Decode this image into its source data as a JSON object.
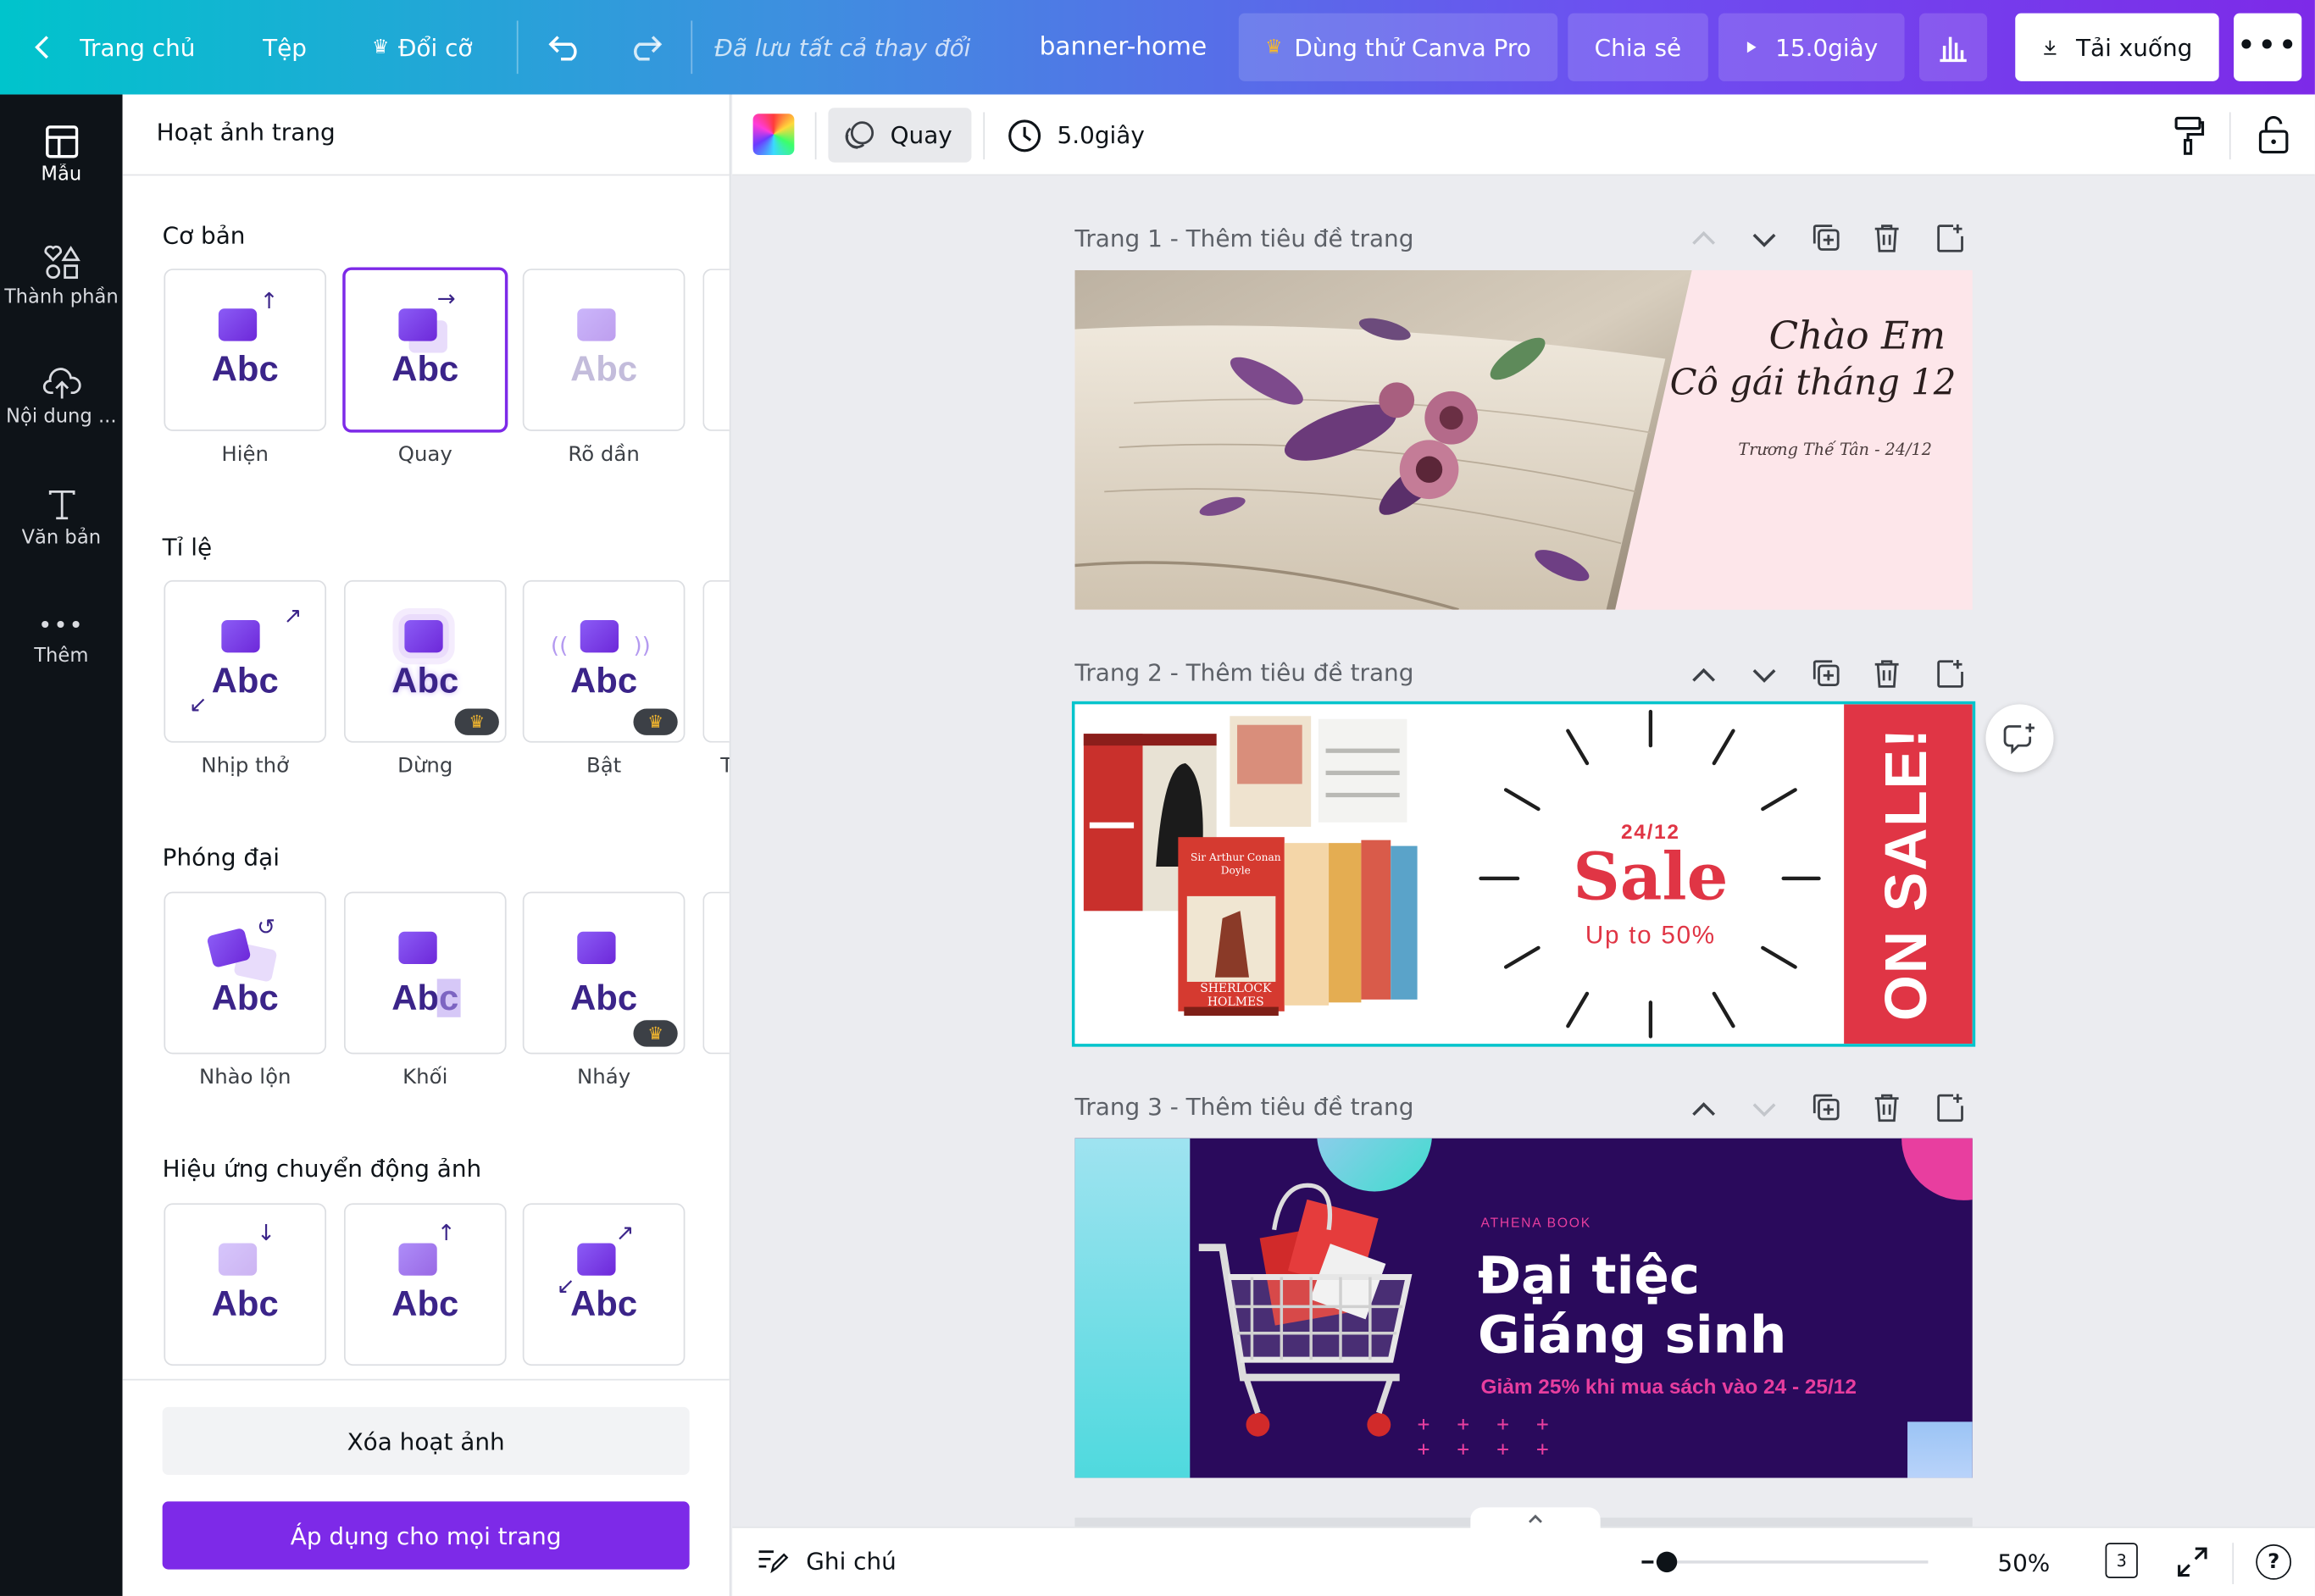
{
  "topbar": {
    "home": "Trang chủ",
    "file": "Tệp",
    "resize": "Đổi cỡ",
    "save_status": "Đã lưu tất cả thay đổi",
    "doc_title": "banner-home",
    "try_pro": "Dùng thử Canva Pro",
    "share": "Chia sẻ",
    "duration": "15.0giây",
    "download": "Tải xuống"
  },
  "rail": [
    {
      "label": "Mẫu",
      "icon": "template-icon"
    },
    {
      "label": "Thành phần",
      "icon": "elements-icon"
    },
    {
      "label": "Nội dung ...",
      "icon": "upload-cloud-icon"
    },
    {
      "label": "Văn bản",
      "icon": "text-icon"
    },
    {
      "label": "Thêm",
      "icon": "more-icon"
    }
  ],
  "panel": {
    "title": "Hoạt ảnh trang",
    "sections": [
      {
        "title": "Cơ bản",
        "tiles": [
          "Hiện",
          "Quay",
          "Rõ dần"
        ],
        "selected": "Quay"
      },
      {
        "title": "Tỉ lệ",
        "tiles": [
          "Nhịp thở",
          "Dừng",
          "Bật"
        ],
        "overflow_label": "T"
      },
      {
        "title": "Phóng đại",
        "tiles": [
          "Nhào lộn",
          "Khối",
          "Nháy"
        ]
      },
      {
        "title": "Hiệu ứng chuyển động ảnh",
        "tiles": [
          "",
          "",
          ""
        ]
      }
    ],
    "tile_text": "Abc",
    "clear_button": "Xóa hoạt ảnh",
    "apply_all_button": "Áp dụng cho mọi trang"
  },
  "toolbar2": {
    "animation": "Quay",
    "timing": "5.0giây"
  },
  "pages": [
    {
      "label": "Trang 1",
      "title_placeholder": "Thêm tiêu đề trang"
    },
    {
      "label": "Trang 2",
      "title_placeholder": "Thêm tiêu đề trang"
    },
    {
      "label": "Trang 3",
      "title_placeholder": "Thêm tiêu đề trang"
    }
  ],
  "page1": {
    "line1": "Chào Em",
    "line2": "Cô gái tháng 12",
    "signature": "Trương Thế Tân - 24/12"
  },
  "page2": {
    "date": "24/12",
    "sale": "Sale",
    "upto": "Up to 50%",
    "banner": "ON SALE!",
    "book_spine": "SHERLOCK HOLMES",
    "book_author": "Sir Arthur Conan Doyle"
  },
  "page3": {
    "brand": "ATHENA BOOK",
    "headline1": "Đại tiệc",
    "headline2": "Giáng sinh",
    "subline": "Giảm 25% khi mua sách vào 24 - 25/12"
  },
  "bottombar": {
    "notes": "Ghi chú",
    "zoom": "50%",
    "page_count": "3"
  },
  "colors": {
    "accent_purple": "#7d2ae8",
    "teal": "#00c4cc",
    "sale_red": "#e03545",
    "page3_bg": "#2a0a5c",
    "page3_pink": "#e83e9f"
  }
}
